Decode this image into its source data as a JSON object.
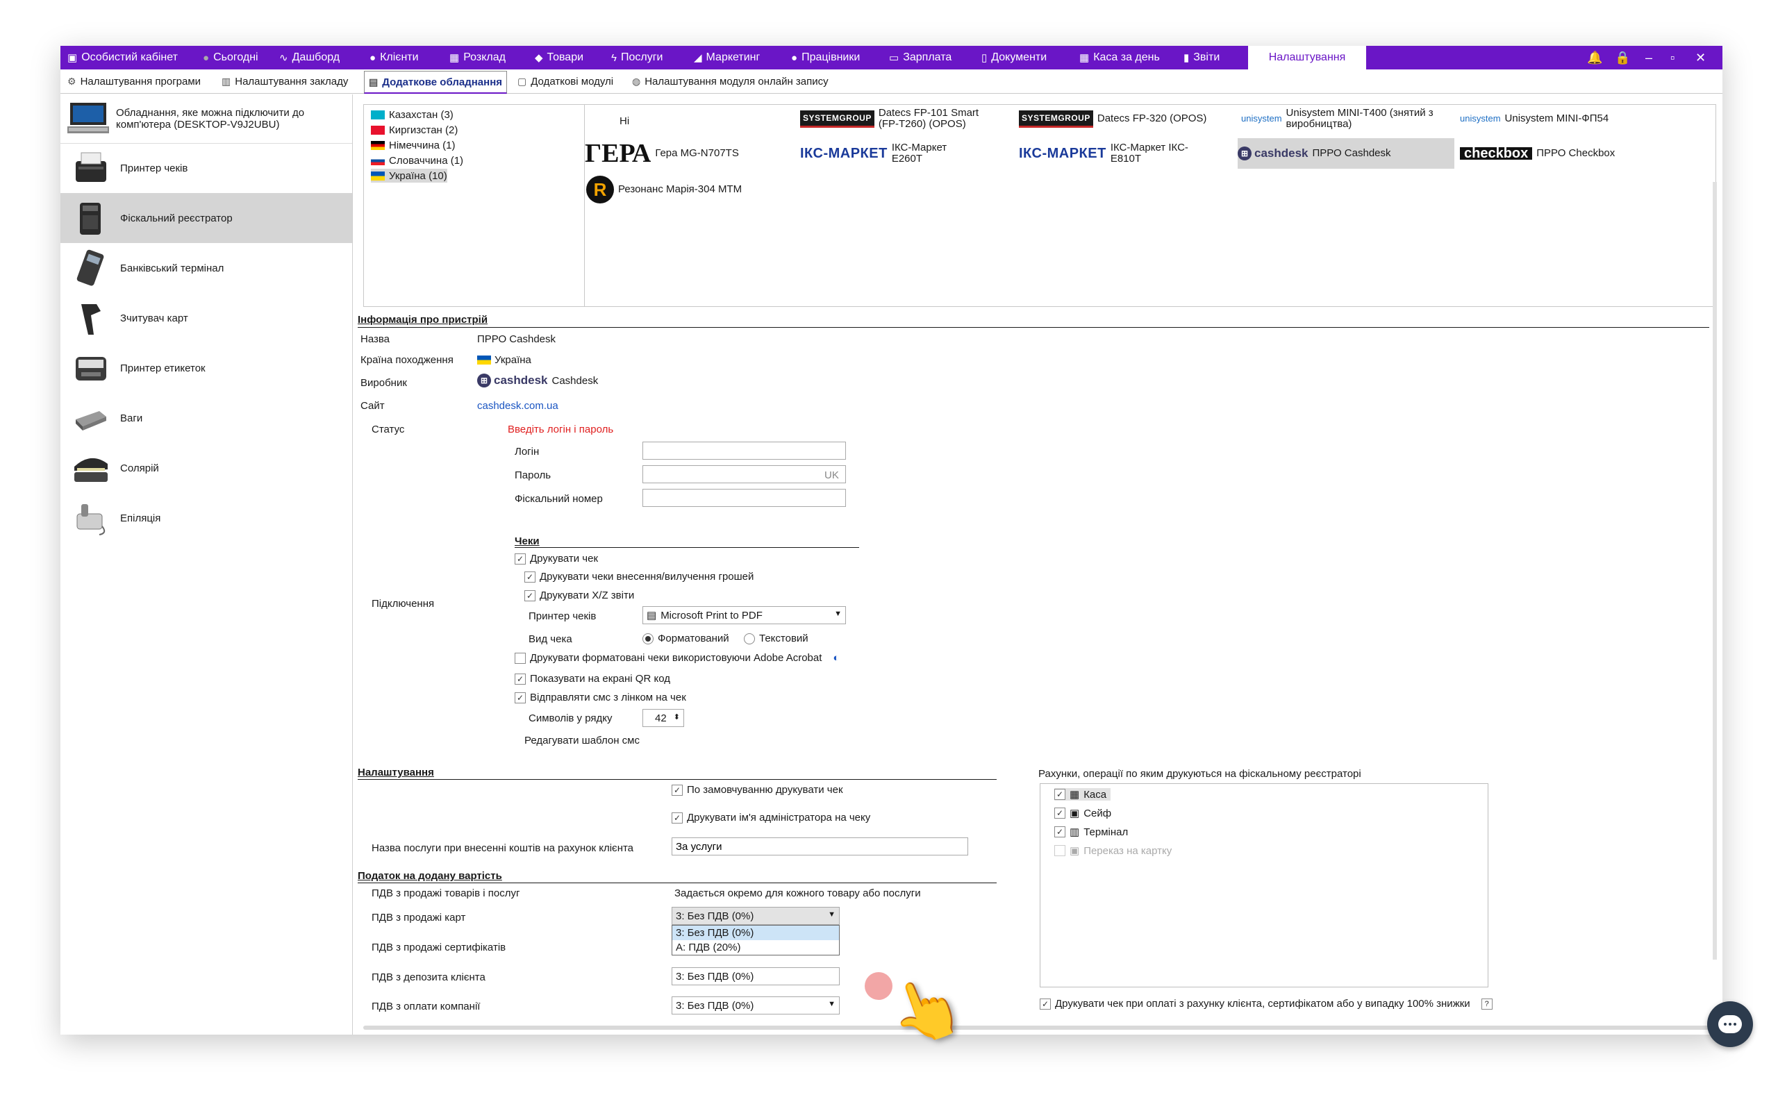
{
  "topnav": {
    "items": [
      {
        "icon": "wallet-icon",
        "glyph": "▣",
        "label": "Особистий кабінет"
      },
      {
        "icon": "clock-icon",
        "glyph": "●",
        "label": "Сьогодні"
      },
      {
        "icon": "pulse-icon",
        "glyph": "∿",
        "label": "Дашборд"
      },
      {
        "icon": "user-circle-icon",
        "glyph": "●",
        "label": "Клієнти"
      },
      {
        "icon": "calendar-icon",
        "glyph": "▦",
        "label": "Розклад"
      },
      {
        "icon": "box-icon",
        "glyph": "◆",
        "label": "Товари"
      },
      {
        "icon": "bolt-icon",
        "glyph": "ϟ",
        "label": "Послуги"
      },
      {
        "icon": "megaphone-icon",
        "glyph": "◢",
        "label": "Маркетинг"
      },
      {
        "icon": "person-icon",
        "glyph": "●",
        "label": "Працівники"
      },
      {
        "icon": "money-icon",
        "glyph": "▭",
        "label": "Зарплата"
      },
      {
        "icon": "document-icon",
        "glyph": "▯",
        "label": "Документи"
      },
      {
        "icon": "calculator-icon",
        "glyph": "▦",
        "label": "Каса за день"
      },
      {
        "icon": "bar-chart-icon",
        "glyph": "▮",
        "label": "Звіти"
      },
      {
        "icon": "",
        "glyph": "",
        "label": "Налаштування"
      }
    ],
    "active_index": 13,
    "controls": {
      "bell": "🔔",
      "lock": "🔒",
      "minimize": "–",
      "restore": "▫",
      "close": "✕"
    }
  },
  "subtabs": [
    {
      "icon": "gear-icon",
      "glyph": "⚙",
      "label": "Налаштування програми"
    },
    {
      "icon": "building-icon",
      "glyph": "▥",
      "label": "Налаштування закладу"
    },
    {
      "icon": "printer-icon",
      "glyph": "▤",
      "label": "Додаткове обладнання"
    },
    {
      "icon": "window-icon",
      "glyph": "▢",
      "label": "Додаткові модулі"
    },
    {
      "icon": "globe-icon",
      "glyph": "◍",
      "label": "Налаштування модуля онлайн запису"
    }
  ],
  "left": {
    "computer_label": "Обладнання, яке можна підключити до комп'ютера (DESKTOP-V9J2UBU)",
    "devices": [
      {
        "name": "receipt-printer",
        "label": "Принтер чеків"
      },
      {
        "name": "fiscal-registrar",
        "label": "Фіскальний реєстратор"
      },
      {
        "name": "bank-terminal",
        "label": "Банківський термінал"
      },
      {
        "name": "card-reader",
        "label": "Зчитувач карт"
      },
      {
        "name": "label-printer",
        "label": "Принтер етикеток"
      },
      {
        "name": "scales",
        "label": "Ваги"
      },
      {
        "name": "solarium",
        "label": "Солярій"
      },
      {
        "name": "epilation",
        "label": "Епіляція"
      }
    ],
    "selected_index": 1
  },
  "countries": [
    {
      "label": "Казахстан (3)",
      "c1": "#00afca",
      "c2": "#00afca"
    },
    {
      "label": "Киргизстан (2)",
      "c1": "#e8112d",
      "c2": "#e8112d"
    },
    {
      "label": "Німеччина (1)",
      "c1": "#000000",
      "c2": "#dd0000"
    },
    {
      "label": "Словаччина (1)",
      "c1": "#ffffff",
      "c2": "#0b4ea2"
    },
    {
      "label": "Україна (10)",
      "c1": "#0057b7",
      "c2": "#ffd700"
    }
  ],
  "country_selected": 4,
  "devices_grid": [
    {
      "logo": "",
      "label": "Ні"
    },
    {
      "logo": "SYSTEMGROUP",
      "label": "Datecs FP-101 Smart (FP-T260) (OPOS)"
    },
    {
      "logo": "SYSTEMGROUP",
      "label": "Datecs FP-320 (OPOS)"
    },
    {
      "logo": "unisystem",
      "label": "Unisystem MINI-T400 (знятий з виробництва)"
    },
    {
      "logo": "unisystem",
      "label": "Unisystem MINI-ФП54"
    },
    {
      "logo": "ГЕРА",
      "label": "Гера MG-N707TS"
    },
    {
      "logo": "ІКС-МАРКЕТ",
      "label": "ІКС-Маркет E260T"
    },
    {
      "logo": "ІКС-МАРКЕТ",
      "label": "ІКС-Маркет ІКС-E810T"
    },
    {
      "logo": "cashdesk",
      "label": "ПРРО Cashdesk"
    },
    {
      "logo": "checkbox",
      "label": "ПРРО Checkbox"
    },
    {
      "logo": "R",
      "label": "Резонанс Марія-304 МТМ"
    }
  ],
  "info": {
    "section_title": "Інформація про пристрій",
    "name_label": "Назва",
    "name_value": "ПРРО Cashdesk",
    "country_label": "Країна походження",
    "country_value": "Україна",
    "maker_label": "Виробник",
    "maker_logo": "cashdesk",
    "maker_value": "Cashdesk",
    "site_label": "Сайт",
    "site_value": "cashdesk.com.ua",
    "status_label": "Статус",
    "status_value": "Введіть логін і пароль"
  },
  "connection": {
    "label": "Підключення",
    "login_label": "Логін",
    "login_value": "",
    "password_label": "Пароль",
    "password_value": "",
    "password_lang": "UK",
    "fiscal_label": "Фіскальний номер",
    "fiscal_value": "",
    "receipts_title": "Чеки",
    "print_receipt": "Друкувати чек",
    "print_cash_ops": "Друкувати чеки внесення/вилучення грошей",
    "print_xz": "Друкувати X/Z звіти",
    "printer_label": "Принтер чеків",
    "printer_value": "Microsoft Print to PDF",
    "view_label": "Вид чека",
    "view_formatted": "Форматований",
    "view_text": "Текстовий",
    "acrobat": "Друкувати форматовані чеки використовуючи Adobe Acrobat",
    "qr": "Показувати на екрані QR код",
    "sms": "Відправляти смс з лінком на чек",
    "chars_label": "Символів у рядку",
    "chars_value": "42",
    "edit_sms": "Редагувати шаблон смс"
  },
  "settings": {
    "title": "Налаштування",
    "default_print": "По замовчуванню друкувати чек",
    "print_admin": "Друкувати ім'я адміністратора на чеку",
    "service_label": "Назва послуги при внесенні коштів на рахунок клієнта",
    "service_value": "За услуги"
  },
  "vat": {
    "title": "Податок на додану вартість",
    "goods_label": "ПДВ з продажі товарів і послуг",
    "goods_value": "Задається окремо для кожного товару або послуги",
    "cards_label": "ПДВ з продажі карт",
    "cards_value": "3: Без ПДВ (0%)",
    "certs_label": "ПДВ з продажі сертифікатів",
    "deposit_label": "ПДВ з депозита клієнта",
    "deposit_value": "3: Без ПДВ (0%)",
    "company_label": "ПДВ з оплати компанії",
    "company_value": "3: Без ПДВ (0%)",
    "dropdown_options": [
      "3: Без ПДВ (0%)",
      "А: ПДВ (20%)"
    ]
  },
  "accounts": {
    "title": "Рахунки, операції по яким друкуються на фіскальному реєстраторі",
    "items": [
      {
        "icon": "calculator-icon",
        "label": "Каса",
        "checked": true
      },
      {
        "icon": "safe-icon",
        "label": "Сейф",
        "checked": true
      },
      {
        "icon": "terminal-icon",
        "label": "Термінал",
        "checked": true
      },
      {
        "icon": "card-transfer-icon",
        "label": "Переказ на картку",
        "checked": false
      }
    ],
    "bottom_check": "Друкувати чек при оплаті з рахунку клієнта, сертифікатом або у випадку 100% знижки",
    "help": "?"
  }
}
